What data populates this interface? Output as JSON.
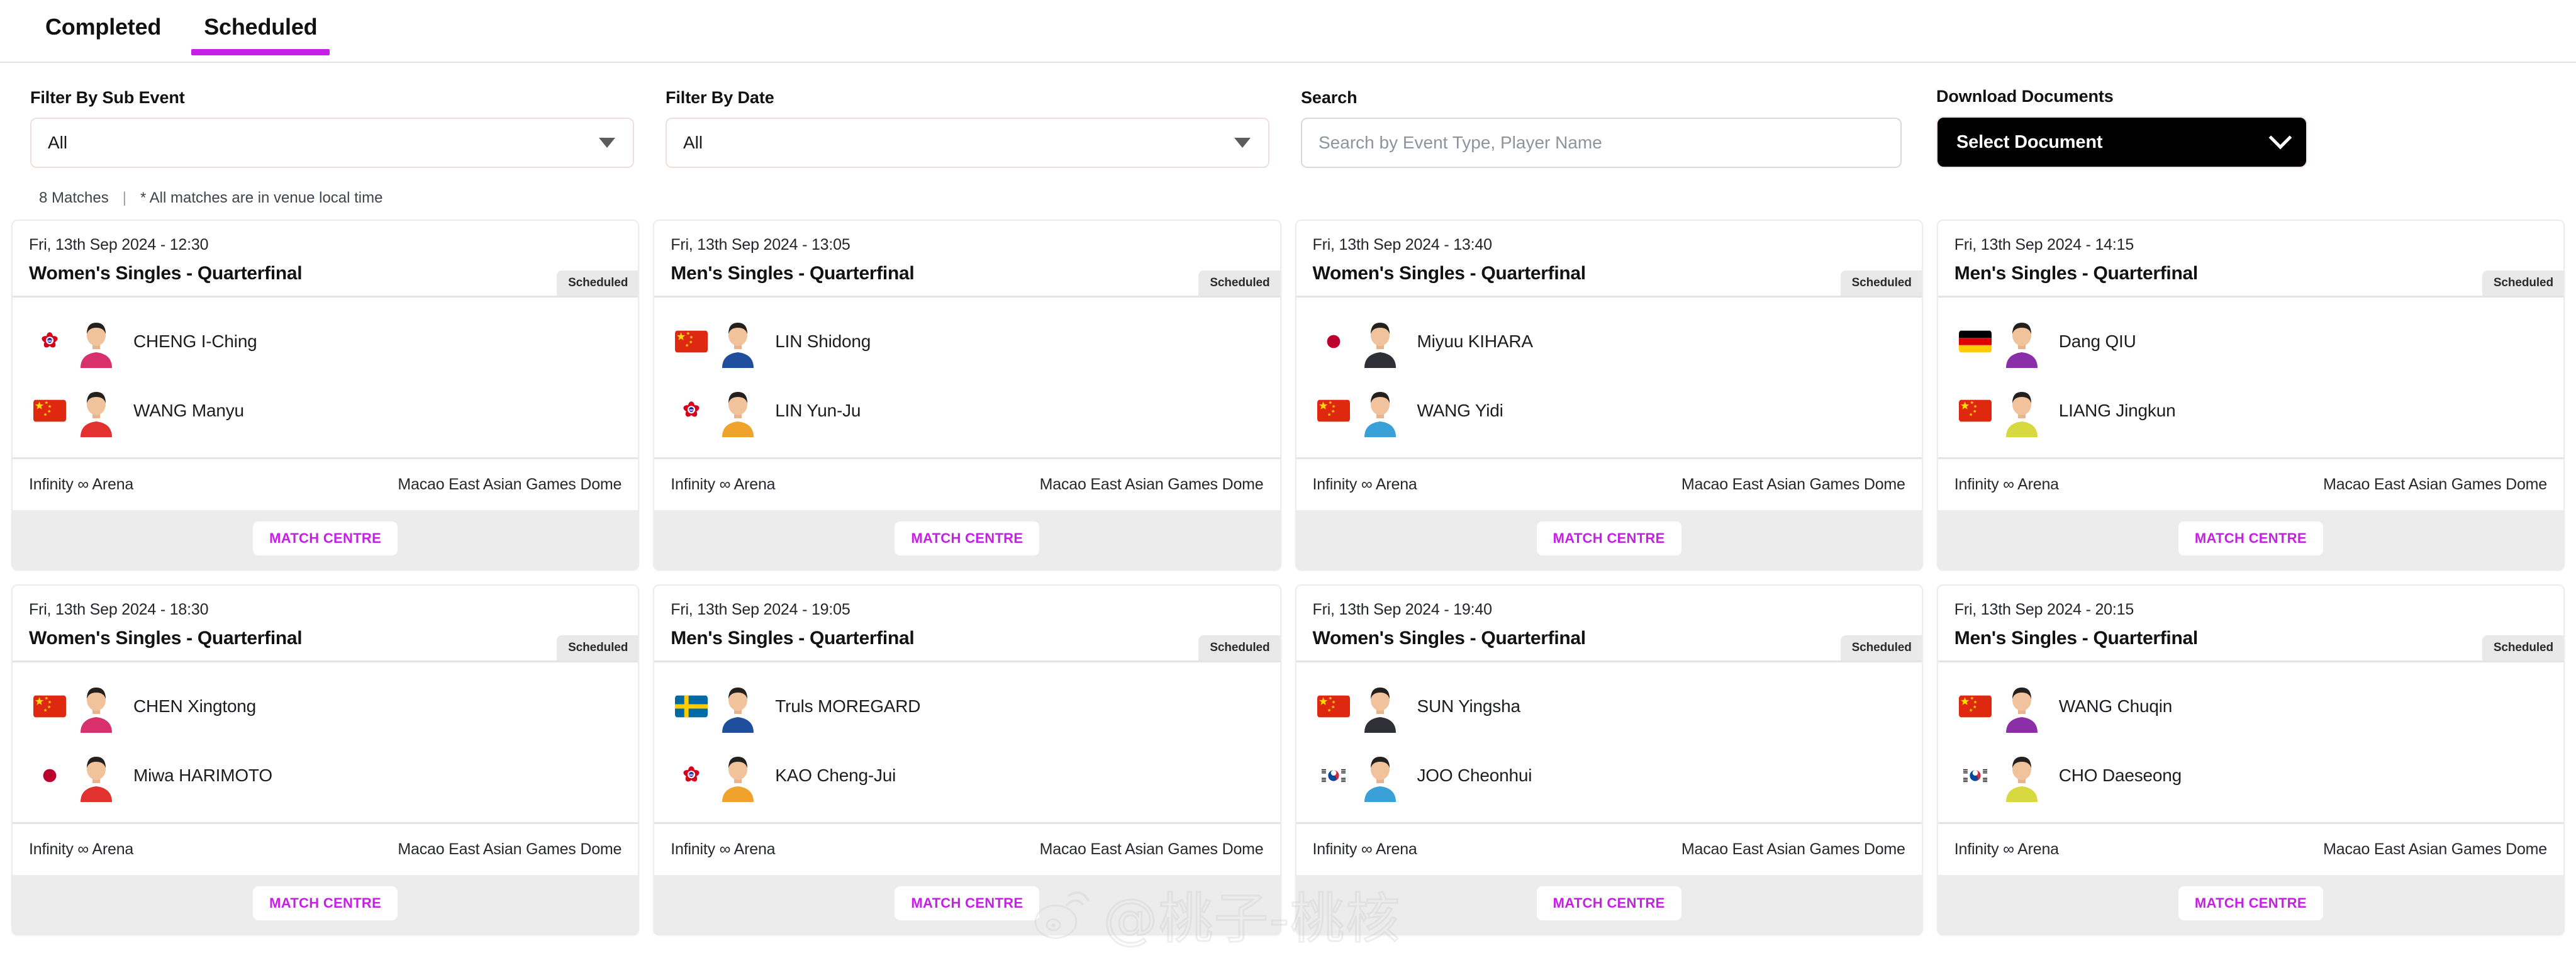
{
  "tabs": [
    {
      "label": "Completed",
      "active": false
    },
    {
      "label": "Scheduled",
      "active": true
    }
  ],
  "filters": {
    "sub_event": {
      "label": "Filter By Sub Event",
      "value": "All",
      "icon": "caret-down-icon"
    },
    "date": {
      "label": "Filter By Date",
      "value": "All",
      "icon": "caret-down-icon"
    },
    "search": {
      "label": "Search",
      "value": "",
      "placeholder": "Search by Event Type, Player Name"
    },
    "documents": {
      "label": "Download Documents",
      "value": "Select Document",
      "icon": "chevron-down-icon"
    }
  },
  "summary": {
    "match_count": "8 Matches",
    "separator": "|",
    "note": "* All matches are in venue local time"
  },
  "colors": {
    "accent": "#c61fe8",
    "badge_bg": "#e9e9e9",
    "button_dark": "#000000",
    "card_footer": "#ececec"
  },
  "common": {
    "status_label": "Scheduled",
    "match_centre_label": "MATCH CENTRE",
    "arena": "Infinity ∞ Arena",
    "venue": "Macao East Asian Games Dome"
  },
  "watermark": {
    "text": "@桃子-桃核",
    "logo": "weibo-logo-icon"
  },
  "matches": [
    {
      "datetime": "Fri, 13th Sep 2024 - 12:30",
      "title": "Women's Singles - Quarterfinal",
      "status": "Scheduled",
      "arena": "Infinity ∞ Arena",
      "venue": "Macao East Asian Games Dome",
      "button": "MATCH CENTRE",
      "players": [
        {
          "name": "CHENG I-Ching",
          "flag": "TPE"
        },
        {
          "name": "WANG Manyu",
          "flag": "CHN"
        }
      ]
    },
    {
      "datetime": "Fri, 13th Sep 2024 - 13:05",
      "title": "Men's Singles - Quarterfinal",
      "status": "Scheduled",
      "arena": "Infinity ∞ Arena",
      "venue": "Macao East Asian Games Dome",
      "button": "MATCH CENTRE",
      "players": [
        {
          "name": "LIN Shidong",
          "flag": "CHN"
        },
        {
          "name": "LIN Yun-Ju",
          "flag": "TPE"
        }
      ]
    },
    {
      "datetime": "Fri, 13th Sep 2024 - 13:40",
      "title": "Women's Singles - Quarterfinal",
      "status": "Scheduled",
      "arena": "Infinity ∞ Arena",
      "venue": "Macao East Asian Games Dome",
      "button": "MATCH CENTRE",
      "players": [
        {
          "name": "Miyuu KIHARA",
          "flag": "JPN"
        },
        {
          "name": "WANG Yidi",
          "flag": "CHN"
        }
      ]
    },
    {
      "datetime": "Fri, 13th Sep 2024 - 14:15",
      "title": "Men's Singles - Quarterfinal",
      "status": "Scheduled",
      "arena": "Infinity ∞ Arena",
      "venue": "Macao East Asian Games Dome",
      "button": "MATCH CENTRE",
      "players": [
        {
          "name": "Dang QIU",
          "flag": "GER"
        },
        {
          "name": "LIANG Jingkun",
          "flag": "CHN"
        }
      ]
    },
    {
      "datetime": "Fri, 13th Sep 2024 - 18:30",
      "title": "Women's Singles - Quarterfinal",
      "status": "Scheduled",
      "arena": "Infinity ∞ Arena",
      "venue": "Macao East Asian Games Dome",
      "button": "MATCH CENTRE",
      "players": [
        {
          "name": "CHEN Xingtong",
          "flag": "CHN"
        },
        {
          "name": "Miwa HARIMOTO",
          "flag": "JPN"
        }
      ]
    },
    {
      "datetime": "Fri, 13th Sep 2024 - 19:05",
      "title": "Men's Singles - Quarterfinal",
      "status": "Scheduled",
      "arena": "Infinity ∞ Arena",
      "venue": "Macao East Asian Games Dome",
      "button": "MATCH CENTRE",
      "players": [
        {
          "name": "Truls MOREGARD",
          "flag": "SWE"
        },
        {
          "name": "KAO Cheng-Jui",
          "flag": "TPE"
        }
      ]
    },
    {
      "datetime": "Fri, 13th Sep 2024 - 19:40",
      "title": "Women's Singles - Quarterfinal",
      "status": "Scheduled",
      "arena": "Infinity ∞ Arena",
      "venue": "Macao East Asian Games Dome",
      "button": "MATCH CENTRE",
      "players": [
        {
          "name": "SUN Yingsha",
          "flag": "CHN"
        },
        {
          "name": "JOO Cheonhui",
          "flag": "KOR"
        }
      ]
    },
    {
      "datetime": "Fri, 13th Sep 2024 - 20:15",
      "title": "Men's Singles - Quarterfinal",
      "status": "Scheduled",
      "arena": "Infinity ∞ Arena",
      "venue": "Macao East Asian Games Dome",
      "button": "MATCH CENTRE",
      "players": [
        {
          "name": "WANG Chuqin",
          "flag": "CHN"
        },
        {
          "name": "CHO Daeseong",
          "flag": "KOR"
        }
      ]
    }
  ]
}
